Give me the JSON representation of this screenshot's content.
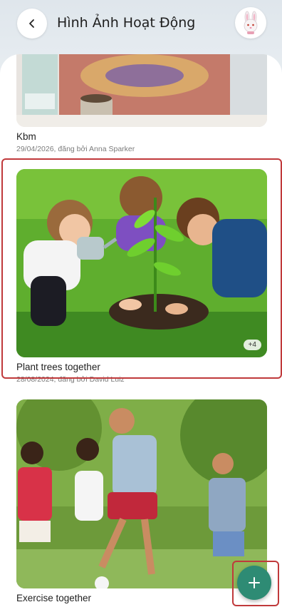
{
  "header": {
    "title": "Hình Ảnh Hoạt Động",
    "back_icon": "chevron-left-icon",
    "avatar_icon": "bunny-avatar-icon"
  },
  "posts": [
    {
      "title": "Kbm",
      "meta": "29/04/2026, đăng bởi Anna Sparker",
      "image": "table-with-drinks-photo"
    },
    {
      "title": "Plant trees together",
      "meta": "28/08/2024, đăng bởi David Luiz",
      "image": "children-planting-tree-photo",
      "extra_count": "+4"
    },
    {
      "title": "Exercise together",
      "meta": "",
      "image": "children-playing-football-photo"
    }
  ],
  "fab": {
    "icon": "plus-icon"
  },
  "colors": {
    "accent": "#2e8b74",
    "highlight": "#c0393b"
  }
}
